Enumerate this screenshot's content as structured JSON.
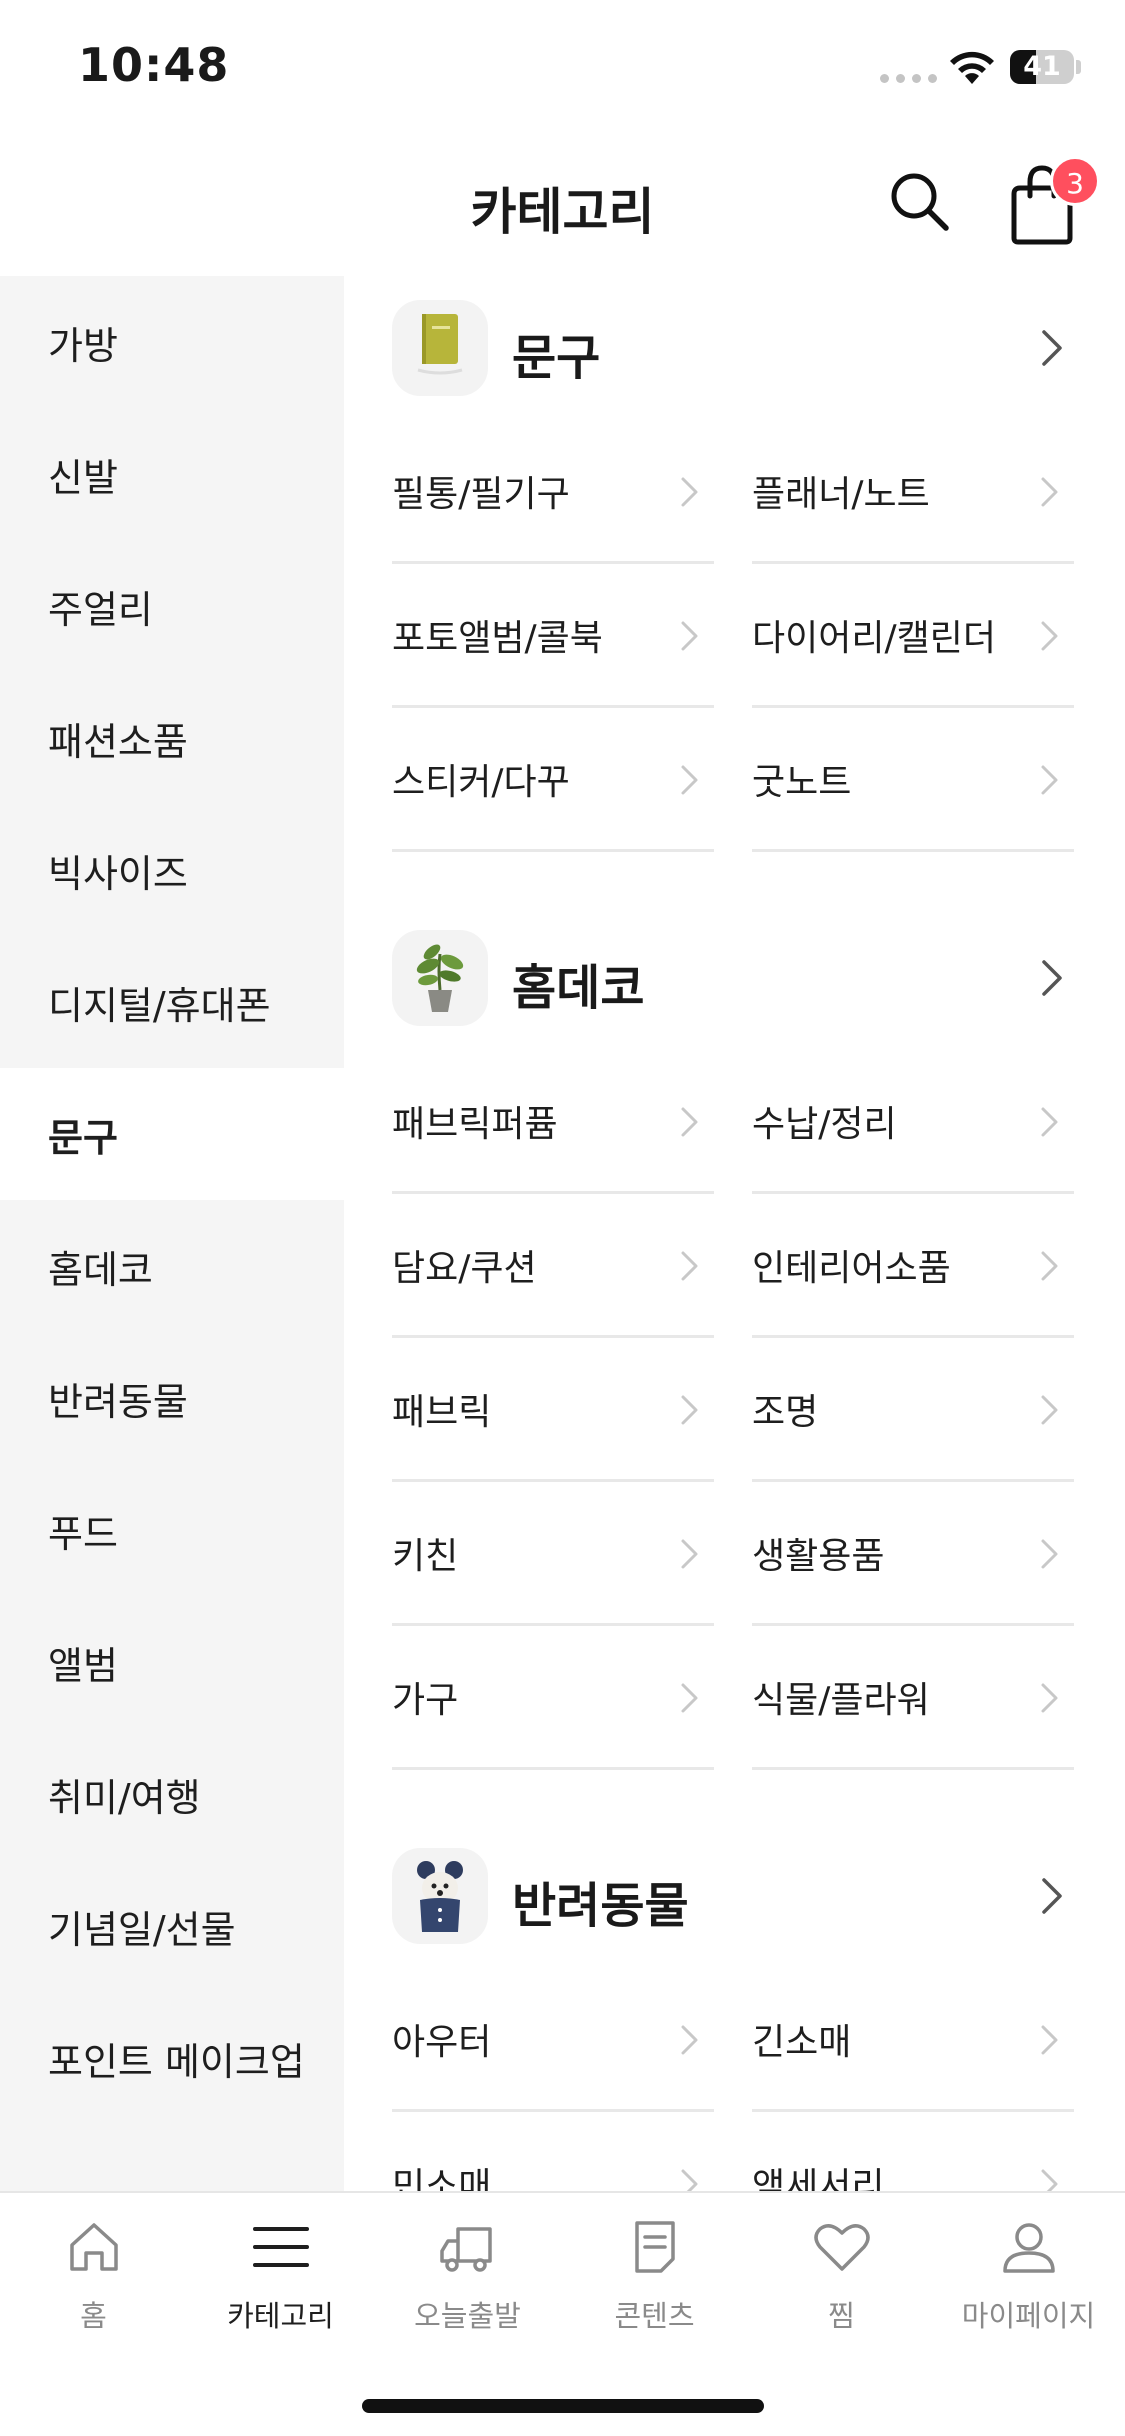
{
  "status_bar": {
    "time": "10:48",
    "battery_level": "41",
    "battery_fraction": 0.41
  },
  "header": {
    "title": "카테고리",
    "cart_count": "3"
  },
  "sidebar": {
    "items": [
      {
        "label": "가방",
        "active": false
      },
      {
        "label": "신발",
        "active": false
      },
      {
        "label": "주얼리",
        "active": false
      },
      {
        "label": "패션소품",
        "active": false
      },
      {
        "label": "빅사이즈",
        "active": false
      },
      {
        "label": "디지털/휴대폰",
        "active": false
      },
      {
        "label": "문구",
        "active": true
      },
      {
        "label": "홈데코",
        "active": false
      },
      {
        "label": "반려동물",
        "active": false
      },
      {
        "label": "푸드",
        "active": false
      },
      {
        "label": "앨범",
        "active": false
      },
      {
        "label": "취미/여행",
        "active": false
      },
      {
        "label": "기념일/선물",
        "active": false
      },
      {
        "label": "포인트 메이크업",
        "active": false
      }
    ]
  },
  "sections": [
    {
      "title": "문구",
      "thumb_icon": "notebook-icon",
      "items": [
        "필통/필기구",
        "플래너/노트",
        "포토앨범/콜북",
        "다이어리/캘린더",
        "스티커/다꾸",
        "굿노트"
      ]
    },
    {
      "title": "홈데코",
      "thumb_icon": "plant-icon",
      "items": [
        "패브릭퍼퓸",
        "수납/정리",
        "담요/쿠션",
        "인테리어소품",
        "패브릭",
        "조명",
        "키친",
        "생활용품",
        "가구",
        "식물/플라워"
      ]
    },
    {
      "title": "반려동물",
      "thumb_icon": "dog-icon",
      "items": [
        "아우터",
        "긴소매",
        "민소매",
        "액세서리"
      ]
    }
  ],
  "tabbar": {
    "tabs": [
      {
        "label": "홈",
        "icon": "home-icon",
        "active": false
      },
      {
        "label": "카테고리",
        "icon": "menu-icon",
        "active": true
      },
      {
        "label": "오늘출발",
        "icon": "truck-icon",
        "active": false
      },
      {
        "label": "콘텐츠",
        "icon": "document-icon",
        "active": false
      },
      {
        "label": "찜",
        "icon": "heart-icon",
        "active": false
      },
      {
        "label": "마이페이지",
        "icon": "user-icon",
        "active": false
      }
    ]
  },
  "colors": {
    "accent_badge": "#ff4f5e",
    "sidebar_bg": "#f5f5f5",
    "divider": "#e8e8e8",
    "inactive_tab": "#8a8a8a"
  }
}
